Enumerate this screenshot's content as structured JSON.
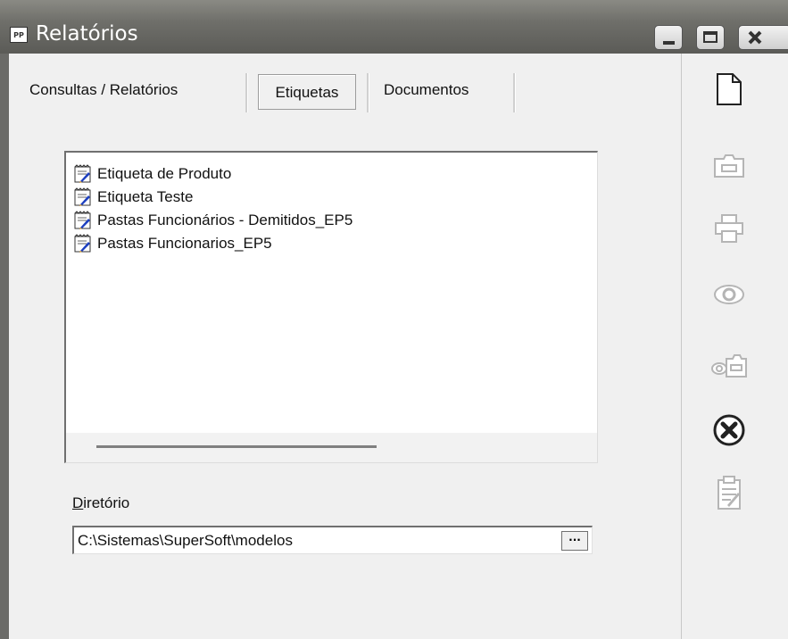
{
  "window": {
    "title": "Relatórios",
    "icon_text": "PP",
    "controls": [
      "minimize-icon",
      "maximize-icon",
      "close-icon"
    ]
  },
  "tabs": [
    {
      "label": "Consultas / Relatórios",
      "active": false
    },
    {
      "label": "Etiquetas",
      "active": true
    },
    {
      "label": "Documentos",
      "active": false
    }
  ],
  "list": {
    "items": [
      "Etiqueta de Produto",
      "Etiqueta Teste",
      "Pastas Funcionários - Demitidos_EP5",
      "Pastas Funcionarios_EP5"
    ]
  },
  "directory": {
    "label_first": "D",
    "label_rest": "iretório",
    "value": "C:\\Sistemas\\SuperSoft\\modelos",
    "browse_label": "···"
  },
  "toolbar": {
    "icons": [
      {
        "name": "new-document-icon",
        "enabled": true
      },
      {
        "name": "open-folder-icon",
        "enabled": false
      },
      {
        "name": "printer-icon",
        "enabled": false
      },
      {
        "name": "preview-eye-icon",
        "enabled": false
      },
      {
        "name": "preview-folder-icon",
        "enabled": false
      },
      {
        "name": "close-circle-icon",
        "enabled": true
      },
      {
        "name": "edit-document-icon",
        "enabled": false
      }
    ]
  },
  "colors": {
    "titlebar": "#6f6f6a",
    "panel": "#f0f0f0",
    "disabled_icon": "#b5b5b5"
  }
}
